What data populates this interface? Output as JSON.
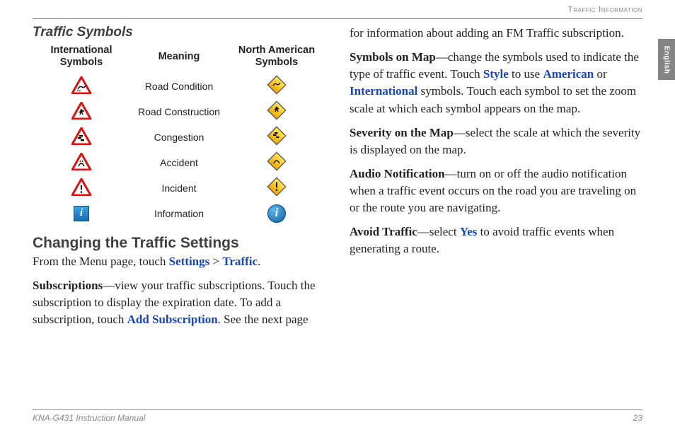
{
  "header": "Traffic Information",
  "language_tab": "English",
  "left": {
    "section_title": "Traffic Symbols",
    "table": {
      "col1": "International Symbols",
      "col2": "Meaning",
      "col3": "North American Symbols",
      "rows": [
        {
          "intl_icon": "tri-skid",
          "meaning": "Road Condition",
          "na_icon": "diamond-skid"
        },
        {
          "intl_icon": "tri-worker",
          "meaning": "Road Construction",
          "na_icon": "diamond-worker"
        },
        {
          "intl_icon": "tri-cars",
          "meaning": "Congestion",
          "na_icon": "diamond-cars"
        },
        {
          "intl_icon": "tri-accident",
          "meaning": "Accident",
          "na_icon": "diamond-accident"
        },
        {
          "intl_icon": "tri-warn",
          "meaning": "Incident",
          "na_icon": "diamond-warn"
        },
        {
          "intl_icon": "info-sq",
          "meaning": "Information",
          "na_icon": "info-circle"
        }
      ]
    },
    "h2": "Changing the Traffic Settings",
    "p1_a": "From the Menu page, touch ",
    "p1_link1": "Settings",
    "p1_sep": " > ",
    "p1_link2": "Traffic",
    "p1_end": ".",
    "p2_bold": "Subscriptions",
    "p2_a": "—view your traffic subscriptions. Touch the subscription to display the expiration date. To add a subscription, touch ",
    "p2_link": "Add Subscription",
    "p2_b": ". See the next page"
  },
  "right": {
    "p0": "for information about adding an FM Traffic subscription.",
    "p1_bold": "Symbols on Map",
    "p1_a": "—change the symbols used to indicate the type of traffic event. Touch ",
    "p1_link1": "Style",
    "p1_b": " to use ",
    "p1_link2": "American",
    "p1_c": " or ",
    "p1_link3": "International",
    "p1_d": " symbols. Touch each symbol to set the zoom scale at which each symbol appears on the map.",
    "p2_bold": "Severity on the Map",
    "p2_a": "—select the scale at which the severity is displayed on the map.",
    "p3_bold": "Audio Notification",
    "p3_a": "—turn on or off the audio notification when a traffic event occurs on the road you are traveling on or the route you are navigating.",
    "p4_bold": "Avoid Traffic",
    "p4_a": "—select ",
    "p4_link": "Yes",
    "p4_b": " to avoid traffic events when generating a route."
  },
  "footer": {
    "left": "KNA-G431 Instruction Manual",
    "right": "23"
  }
}
